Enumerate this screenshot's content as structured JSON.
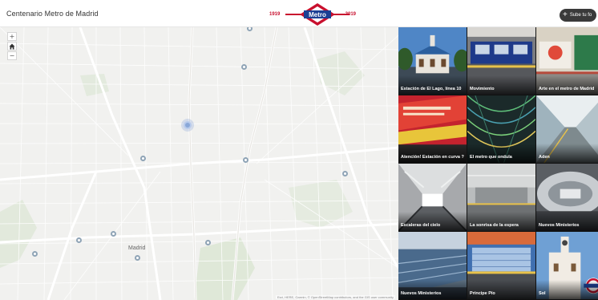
{
  "header": {
    "app_title": "Centenario Metro de Madrid",
    "logo_text": "Metro",
    "year_left": "1919",
    "year_right": "2019",
    "upload_button_label": "Sube tu fo",
    "upload_icon": "plus-icon"
  },
  "map": {
    "zoom_in": "+",
    "home_icon": "home-icon",
    "zoom_out": "−",
    "city_label": "Madrid",
    "attribution": "Esri, HERE, Garmin, © OpenStreetMap contributors, and the GIS user community"
  },
  "gallery": {
    "tiles": [
      {
        "caption": "Estación de El Lago, línea 10"
      },
      {
        "caption": "Movimiento"
      },
      {
        "caption": "Arte en el metro de Madrid"
      },
      {
        "caption": "Atención! Estación en curva ?"
      },
      {
        "caption": "El metro que ondula"
      },
      {
        "caption": "Aden"
      },
      {
        "caption": "Escaleras del cielo"
      },
      {
        "caption": "La sonrisa de la espera"
      },
      {
        "caption": "Nuevos Ministerios"
      },
      {
        "caption": "Nuevos Ministerios"
      },
      {
        "caption": "Príncipe Pío"
      },
      {
        "caption": "Sol"
      }
    ]
  },
  "colors": {
    "brand_red": "#c8102e",
    "brand_blue": "#1c3f94",
    "map_background": "#f1f1ef",
    "marker_stroke": "#8fa4b6"
  }
}
